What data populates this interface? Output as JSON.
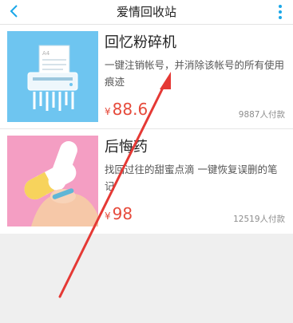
{
  "header": {
    "title": "爱情回收站",
    "back_icon": "chevron-left-icon",
    "more_icon": "more-vertical-icon",
    "accent": "#1aa7e8"
  },
  "items": [
    {
      "title": "回忆粉碎机",
      "description": "一键注销帐号，并消除该帐号的所有使用痕迹",
      "currency": "¥",
      "price": "88.6",
      "purchase_count": "9887人付款",
      "icon": "paper-shredder-icon",
      "thumb_color": "#6ec5f0"
    },
    {
      "title": "后悔药",
      "description": "找回过往的甜蜜点滴 一键恢复误删的笔记",
      "currency": "¥",
      "price": "98",
      "purchase_count": "12519人付款",
      "icon": "pill-capsule-icon",
      "thumb_color": "#f49ec3"
    }
  ],
  "colors": {
    "price": "#e64a3b",
    "annotation_arrow": "#e53935"
  }
}
